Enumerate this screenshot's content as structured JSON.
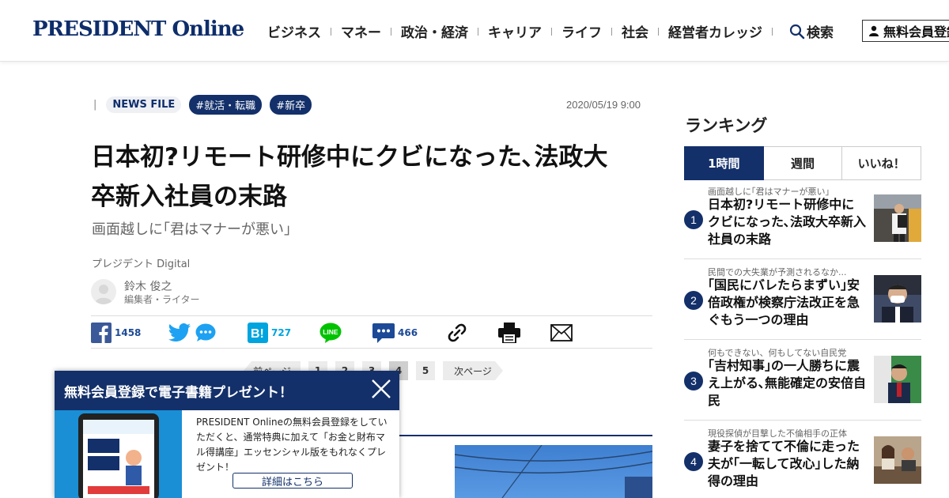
{
  "header": {
    "logo": "PRESIDENT Online",
    "nav": [
      "ビジネス",
      "マネー",
      "政治・経済",
      "キャリア",
      "ライフ",
      "社会",
      "経営者カレッジ"
    ],
    "search_label": "検索",
    "register_label": "無料会員登録"
  },
  "article": {
    "category": "NEWS FILE",
    "tags": [
      "#就活・転職",
      "#新卒"
    ],
    "date": "2020/05/19 9:00",
    "title_line1": "日本初?リモート研修中にクビになった､法政大",
    "title_line2": "卒新入社員の末路",
    "subtitle": "画面越しに｢君はマナーが悪い｣",
    "source": "プレジデント Digital",
    "author_name": "鈴木 俊之",
    "author_role": "編集者・ライター"
  },
  "share": {
    "facebook_count": "1458",
    "hatena_count": "727",
    "comment_count": "466"
  },
  "pagination": {
    "prev": "前ページ",
    "pages": [
      "1",
      "2",
      "3",
      "4",
      "5"
    ],
    "current": "4",
    "next": "次ページ"
  },
  "popup": {
    "title": "無料会員登録で電子書籍プレゼント！",
    "body": "PRESIDENT Onlineの無料会員登録をしていただくと、通常特典に加えて「お金と財布マル得講座」エッセンシャル版をもれなくプレゼント！",
    "button": "詳細はこちら"
  },
  "ranking": {
    "title": "ランキング",
    "tabs": [
      "1時間",
      "週間",
      "いいね！"
    ],
    "items": [
      {
        "num": "1",
        "kicker": "画面越しに｢君はマナーが悪い｣",
        "headline": "日本初?リモート研修中にクビになった､法政大卒新入社員の末路"
      },
      {
        "num": "2",
        "kicker": "民間での大失業が予測されるなか...",
        "headline": "｢国民にバレたらまずい｣安倍政権が検察庁法改正を急ぐもう一つの理由"
      },
      {
        "num": "3",
        "kicker": "何もできない、何もしてない自民党",
        "headline": "｢吉村知事｣の一人勝ちに震え上がる､無能確定の安倍自民"
      },
      {
        "num": "4",
        "kicker": "現役探偵が目撃した不倫相手の正体",
        "headline": "妻子を捨てて不倫に走った夫が｢一転して改心｣した納得の理由"
      }
    ]
  },
  "colors": {
    "brand_navy": "#13306a",
    "facebook": "#3b5998",
    "twitter": "#1da1f2",
    "hatena": "#00a4de",
    "line": "#00c300"
  }
}
